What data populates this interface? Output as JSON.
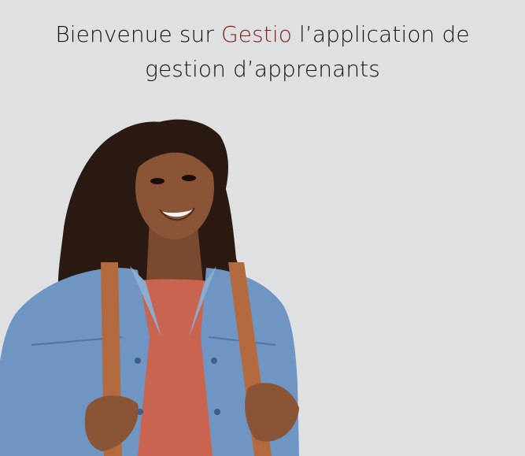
{
  "welcome": {
    "line1_before": "Bienvenue sur ",
    "brand": "Gestio",
    "line1_after": " l’application de",
    "line2": "gestion d’apprenants"
  },
  "colors": {
    "background": "#dfe0e2",
    "text": "#111111",
    "brand": "#8b1a1a"
  },
  "hero_image": {
    "icon": "student-photo"
  }
}
